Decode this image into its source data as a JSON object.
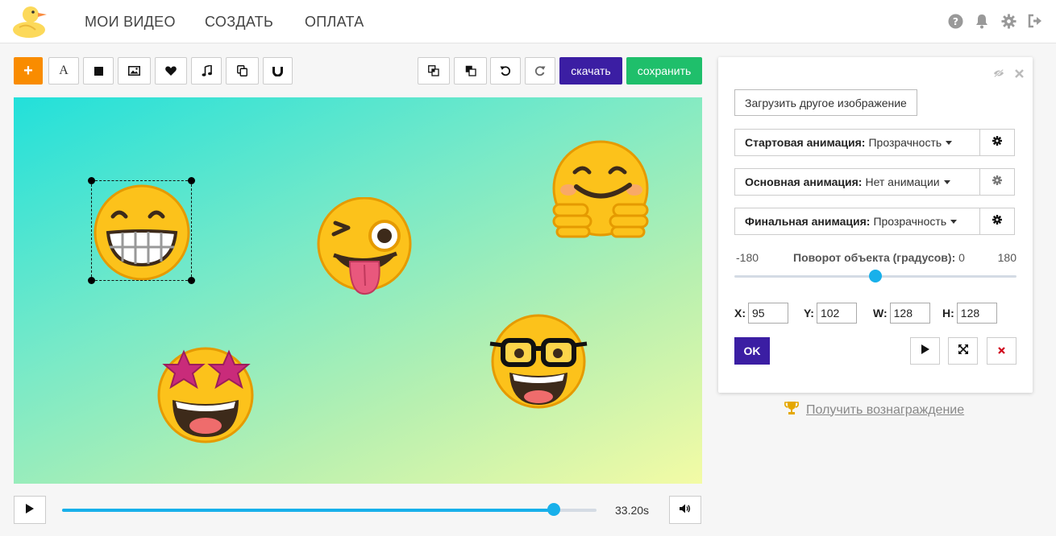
{
  "nav": {
    "items": [
      "МОИ ВИДЕО",
      "СОЗДАТЬ",
      "ОПЛАТА"
    ]
  },
  "toolbar": {
    "add_label": "+",
    "text_label": "A",
    "download_label": "скачать",
    "save_label": "сохранить"
  },
  "player": {
    "time": "33.20s",
    "progress_fraction": 0.92
  },
  "panel": {
    "load_button": "Загрузить другое изображение",
    "start_anim_label": "Стартовая анимация:",
    "start_anim_value": "Прозрачность",
    "main_anim_label": "Основная анимация:",
    "main_anim_value": "Нет анимации",
    "final_anim_label": "Финальная анимация:",
    "final_anim_value": "Прозрачность",
    "rotation": {
      "min": "-180",
      "max": "180",
      "title": "Поворот объекта (градусов):",
      "value": "0",
      "value_num": 0
    },
    "x_label": "X:",
    "x_value": "95",
    "y_label": "Y:",
    "y_value": "102",
    "w_label": "W:",
    "w_value": "128",
    "h_label": "H:",
    "h_value": "128",
    "ok_label": "OK"
  },
  "reward": {
    "label": "Получить вознаграждение"
  },
  "colors": {
    "accent_orange": "#f98c00",
    "accent_purple": "#3b1ea3",
    "accent_green": "#1fbf6b",
    "slider_blue": "#18b0ea"
  },
  "canvas_items": [
    "grinning-emoji",
    "winking-tongue-emoji",
    "hugging-emoji",
    "star-struck-emoji",
    "nerd-emoji"
  ]
}
